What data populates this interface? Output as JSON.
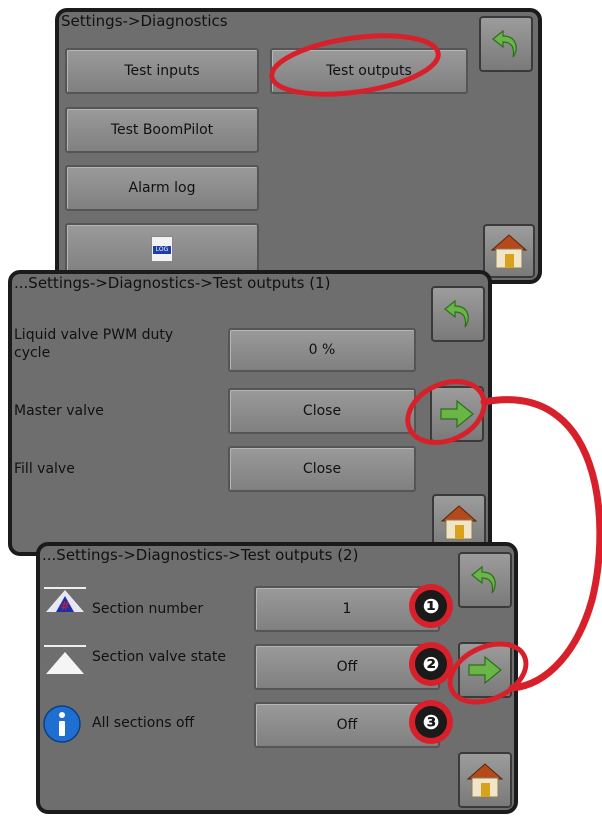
{
  "panel1": {
    "title": "Settings->Diagnostics",
    "buttons": {
      "test_inputs": "Test inputs",
      "test_outputs": "Test outputs",
      "test_boompilot": "Test BoomPilot",
      "alarm_log": "Alarm log",
      "log_icon_text": "LOG"
    }
  },
  "panel2": {
    "title": "...Settings->Diagnostics->Test outputs (1)",
    "rows": [
      {
        "label": "Liquid valve PWM duty cycle",
        "value": "0 %"
      },
      {
        "label": "Master valve",
        "value": "Close"
      },
      {
        "label": "Fill valve",
        "value": "Close"
      }
    ]
  },
  "panel3": {
    "title": "...Settings->Diagnostics->Test outputs (2)",
    "rows": [
      {
        "label": "Section number",
        "value": "1"
      },
      {
        "label": "Section valve state",
        "value": "Off"
      },
      {
        "label": "All sections off",
        "value": "Off"
      }
    ]
  },
  "callouts": [
    "❶",
    "❷",
    "❸"
  ],
  "icons": {
    "back": "back-arrow-icon",
    "home": "home-icon",
    "next": "next-arrow-icon",
    "section_number": "section-number-icon",
    "section_valve": "section-valve-icon",
    "info": "info-icon"
  },
  "colors": {
    "panel_bg": "#6e6e6e",
    "button_bg": "#8c8c8c",
    "arrow_green": "#69b545",
    "annotation_red": "#d8202b"
  }
}
